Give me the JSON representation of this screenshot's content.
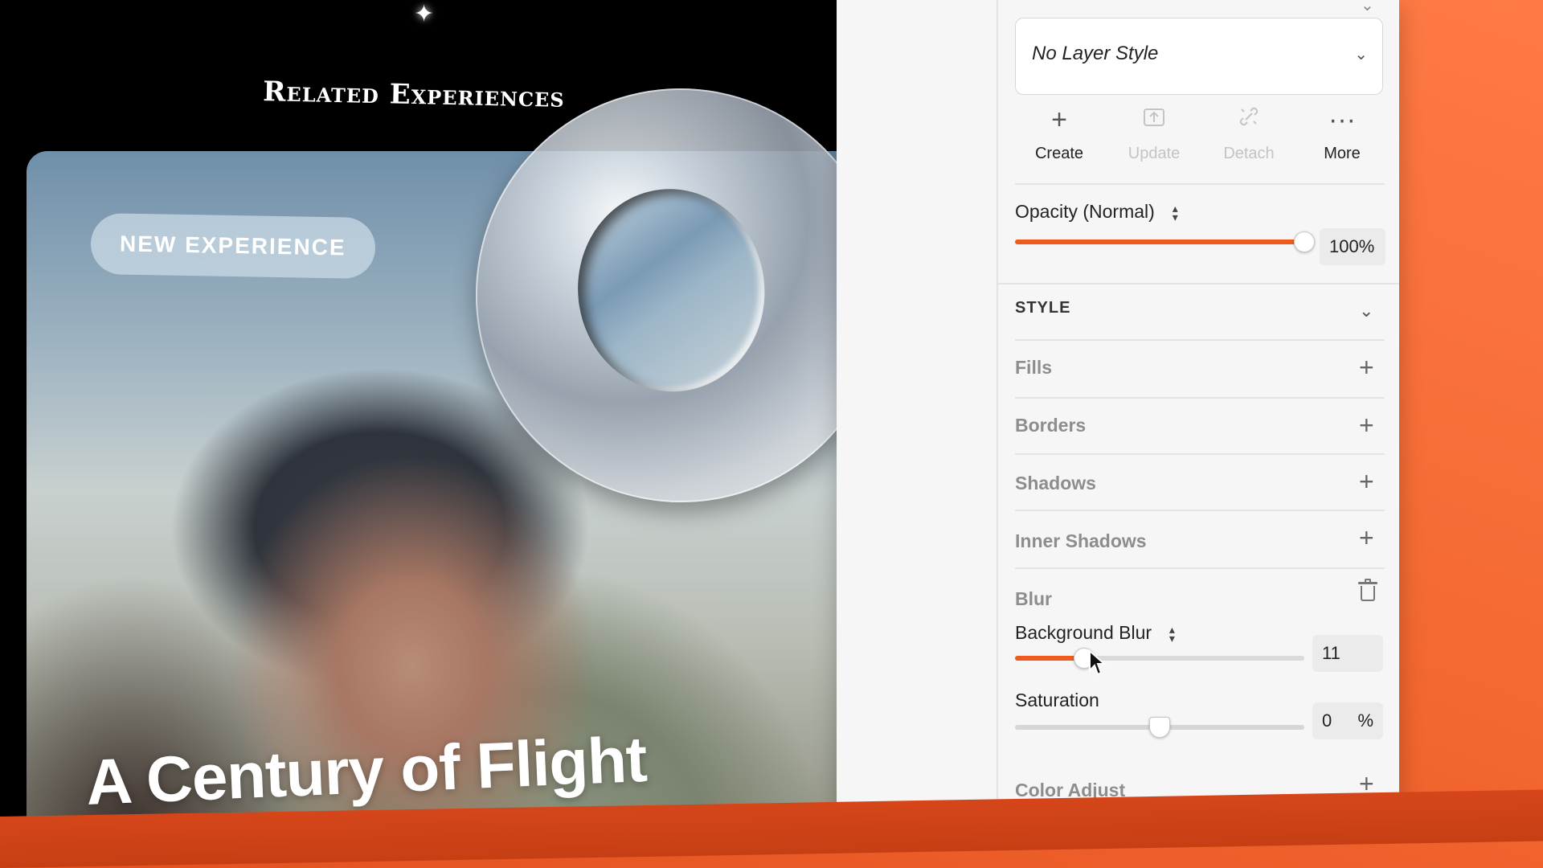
{
  "canvas": {
    "section_title": "Related Experiences",
    "card": {
      "badge": "NEW EXPERIENCE",
      "title": "A Century of Flight"
    }
  },
  "inspector": {
    "layer_style": {
      "value": "No Layer Style",
      "chevron_icon": "chevron-down-icon"
    },
    "actions": [
      {
        "label": "Create",
        "icon": "plus-icon",
        "enabled": true
      },
      {
        "label": "Update",
        "icon": "upload-icon",
        "enabled": false
      },
      {
        "label": "Detach",
        "icon": "unlink-icon",
        "enabled": false
      },
      {
        "label": "More",
        "icon": "ellipsis-icon",
        "enabled": true
      }
    ],
    "opacity": {
      "label": "Opacity (Normal)",
      "value": "100%",
      "fraction": 1.0
    },
    "style_section": {
      "header": "STYLE",
      "rows": [
        {
          "label": "Fills",
          "icon": "plus-icon"
        },
        {
          "label": "Borders",
          "icon": "plus-icon"
        },
        {
          "label": "Shadows",
          "icon": "plus-icon"
        },
        {
          "label": "Inner Shadows",
          "icon": "plus-icon"
        }
      ],
      "blur": {
        "label": "Blur",
        "delete_icon": "trash-icon",
        "type_label": "Background Blur",
        "amount": "11",
        "amount_fraction": 0.24,
        "saturation_label": "Saturation",
        "saturation": "0",
        "saturation_unit": "%",
        "saturation_fraction": 0.5
      },
      "color_adjust": {
        "label": "Color Adjust",
        "icon": "plus-icon"
      }
    }
  },
  "colors": {
    "accent": "#f05a1e",
    "background": "#f36a32"
  }
}
